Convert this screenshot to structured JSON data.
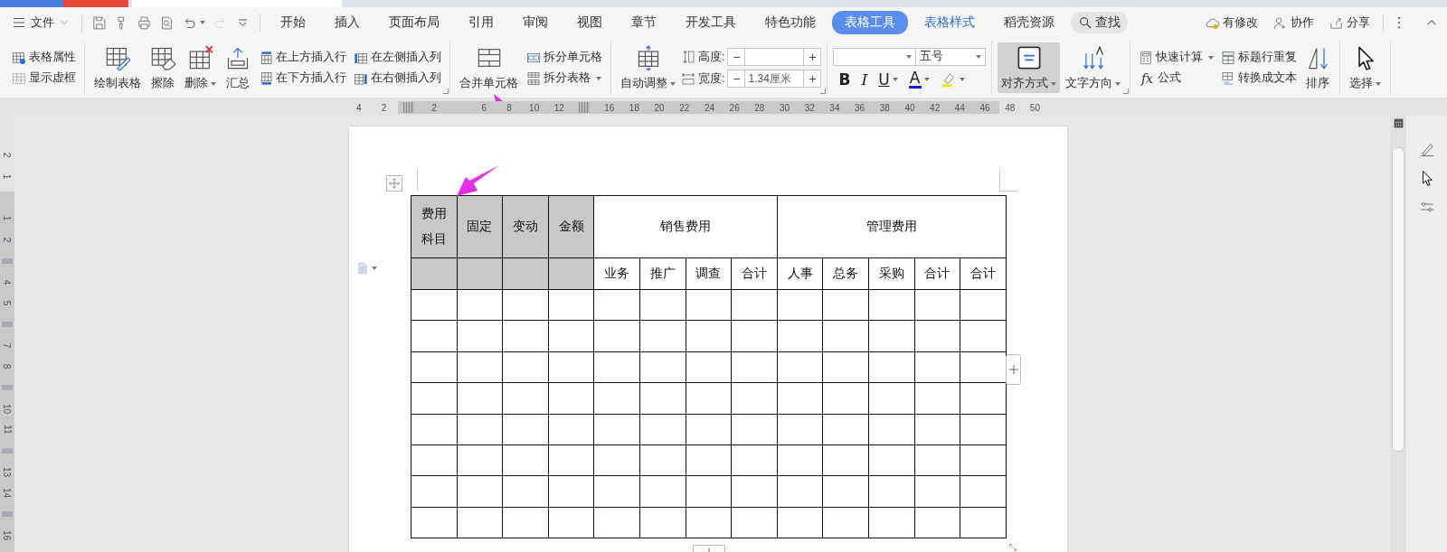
{
  "menu_bar": {
    "file_menu": "文件",
    "quick_access": [
      {
        "kind": "save",
        "dropdown": false,
        "disabled": false
      },
      {
        "kind": "format-painter",
        "dropdown": false,
        "disabled": false
      },
      {
        "kind": "print",
        "dropdown": false,
        "disabled": false
      },
      {
        "kind": "preview",
        "dropdown": false,
        "disabled": false
      },
      {
        "kind": "undo",
        "dropdown": true,
        "disabled": false
      },
      {
        "kind": "redo",
        "dropdown": false,
        "disabled": true
      },
      {
        "kind": "customize",
        "dropdown": false,
        "disabled": false
      }
    ],
    "tabs": [
      {
        "label": "开始",
        "selected": false,
        "contextual": false
      },
      {
        "label": "插入",
        "selected": false,
        "contextual": false
      },
      {
        "label": "页面布局",
        "selected": false,
        "contextual": false
      },
      {
        "label": "引用",
        "selected": false,
        "contextual": false
      },
      {
        "label": "审阅",
        "selected": false,
        "contextual": false
      },
      {
        "label": "视图",
        "selected": false,
        "contextual": false
      },
      {
        "label": "章节",
        "selected": false,
        "contextual": false
      },
      {
        "label": "开发工具",
        "selected": false,
        "contextual": false
      },
      {
        "label": "特色功能",
        "selected": false,
        "contextual": false
      },
      {
        "label": "表格工具",
        "selected": true,
        "contextual": true
      },
      {
        "label": "表格样式",
        "selected": false,
        "contextual": true
      },
      {
        "label": "稻壳资源",
        "selected": false,
        "contextual": false
      }
    ],
    "search": "查找",
    "actions": [
      {
        "kind": "cloud",
        "label": "有修改"
      },
      {
        "kind": "person-plus",
        "label": "协作"
      },
      {
        "kind": "share",
        "label": "分享"
      }
    ]
  },
  "ribbon": {
    "groups": [
      {
        "launcher": false,
        "items": [
          {
            "kind": "stack",
            "buttons": [
              {
                "label": "表格属性",
                "dropdown": false
              },
              {
                "label": "显示虚框",
                "dropdown": false
              }
            ]
          }
        ]
      },
      {
        "launcher": true,
        "items": [
          {
            "kind": "large",
            "label": "绘制表格",
            "dropdown": false,
            "selected": false
          },
          {
            "kind": "large",
            "label": "擦除",
            "dropdown": false,
            "selected": false
          },
          {
            "kind": "large",
            "label": "删除",
            "dropdown": true,
            "selected": false
          },
          {
            "kind": "large",
            "label": "汇总",
            "dropdown": false,
            "selected": false
          },
          {
            "kind": "stack",
            "buttons": [
              {
                "label": "在上方插入行",
                "dropdown": false
              },
              {
                "label": "在下方插入行",
                "dropdown": false
              }
            ]
          },
          {
            "kind": "stack",
            "buttons": [
              {
                "label": "在左侧插入列",
                "dropdown": false
              },
              {
                "label": "在右侧插入列",
                "dropdown": false
              }
            ]
          }
        ]
      },
      {
        "launcher": false,
        "items": [
          {
            "kind": "large",
            "label": "合并单元格",
            "dropdown": false,
            "selected": false
          },
          {
            "kind": "stack",
            "buttons": [
              {
                "label": "拆分单元格",
                "dropdown": false
              },
              {
                "label": "拆分表格",
                "dropdown": true
              }
            ]
          }
        ]
      },
      {
        "launcher": true,
        "items": [
          {
            "kind": "large",
            "label": "自动调整",
            "dropdown": true,
            "selected": false
          },
          {
            "kind": "spin",
            "rows": [
              {
                "label": "高度:",
                "decrement": "−",
                "increment": "+"
              },
              {
                "label": "宽度:",
                "value": "1.34厘米",
                "decrement": "−",
                "increment": "+"
              }
            ]
          }
        ]
      },
      {
        "launcher": false,
        "items": [
          {
            "kind": "font",
            "size": "五号",
            "formats": [
              {
                "kind": "bold",
                "text": "B",
                "dropdown": false
              },
              {
                "kind": "italic",
                "text": "I",
                "dropdown": false
              },
              {
                "kind": "underline",
                "text": "U",
                "dropdown": true
              },
              {
                "kind": "color",
                "text": "A",
                "dropdown": true,
                "color": "#1a1ad0"
              },
              {
                "kind": "highlight",
                "dropdown": true,
                "color": "#f2e600"
              }
            ]
          }
        ]
      },
      {
        "launcher": true,
        "items": [
          {
            "kind": "large",
            "label": "对齐方式",
            "dropdown": true,
            "selected": true
          },
          {
            "kind": "large",
            "label": "文字方向",
            "dropdown": true,
            "selected": false
          }
        ]
      },
      {
        "launcher": false,
        "items": [
          {
            "kind": "stack",
            "buttons": [
              {
                "label": "快速计算",
                "dropdown": true
              },
              {
                "label": "公式",
                "icon_text": "fx",
                "dropdown": false
              }
            ]
          },
          {
            "kind": "stack",
            "buttons": [
              {
                "label": "标题行重复",
                "dropdown": false
              },
              {
                "label": "转换成文本",
                "dropdown": false
              }
            ]
          },
          {
            "kind": "large",
            "label": "排序",
            "dropdown": false,
            "selected": false
          }
        ]
      },
      {
        "launcher": false,
        "items": [
          {
            "kind": "large",
            "label": "选择",
            "dropdown": true,
            "selected": false
          }
        ]
      }
    ]
  },
  "horizontal_ruler": [
    {
      "kind": "number",
      "text": "4"
    },
    {
      "kind": "number",
      "text": "2"
    },
    {
      "kind": "marker"
    },
    {
      "kind": "number",
      "text": "2"
    },
    {
      "kind": "blank"
    },
    {
      "kind": "number",
      "text": "6"
    },
    {
      "kind": "number",
      "text": "8"
    },
    {
      "kind": "number",
      "text": "10"
    },
    {
      "kind": "number",
      "text": "12"
    },
    {
      "kind": "marker"
    },
    {
      "kind": "number",
      "text": "16"
    },
    {
      "kind": "number",
      "text": "18"
    },
    {
      "kind": "number",
      "text": "20"
    },
    {
      "kind": "number",
      "text": "22"
    },
    {
      "kind": "number",
      "text": "24"
    },
    {
      "kind": "number",
      "text": "26"
    },
    {
      "kind": "number",
      "text": "28"
    },
    {
      "kind": "number",
      "text": "30"
    },
    {
      "kind": "number",
      "text": "32"
    },
    {
      "kind": "number",
      "text": "34"
    },
    {
      "kind": "number",
      "text": "36"
    },
    {
      "kind": "number",
      "text": "38"
    },
    {
      "kind": "number",
      "text": "40"
    },
    {
      "kind": "number",
      "text": "42"
    },
    {
      "kind": "number",
      "text": "44"
    },
    {
      "kind": "number",
      "text": "46"
    },
    {
      "kind": "number",
      "text": "48"
    },
    {
      "kind": "number",
      "text": "50"
    }
  ],
  "vertical_ruler": [
    {
      "kind": "number",
      "text": "2"
    },
    {
      "kind": "number",
      "text": "1"
    },
    {
      "kind": "blank"
    },
    {
      "kind": "number",
      "text": "1"
    },
    {
      "kind": "number",
      "text": "2"
    },
    {
      "kind": "marker"
    },
    {
      "kind": "number",
      "text": "4"
    },
    {
      "kind": "number",
      "text": "5"
    },
    {
      "kind": "marker"
    },
    {
      "kind": "number",
      "text": "7"
    },
    {
      "kind": "number",
      "text": "8"
    },
    {
      "kind": "marker"
    },
    {
      "kind": "number",
      "text": "10"
    },
    {
      "kind": "number",
      "text": "11"
    },
    {
      "kind": "marker"
    },
    {
      "kind": "number",
      "text": "13"
    },
    {
      "kind": "number",
      "text": "14"
    },
    {
      "kind": "marker"
    },
    {
      "kind": "number",
      "text": "16"
    }
  ],
  "table": {
    "fixed_columns": [
      {
        "lines": [
          "费用",
          "科目"
        ],
        "shaded": true
      },
      {
        "lines": [
          "固定"
        ],
        "shaded": true
      },
      {
        "lines": [
          "变动"
        ],
        "shaded": true
      },
      {
        "lines": [
          "金额"
        ],
        "shaded": true
      }
    ],
    "groups": [
      {
        "title": "销售费用",
        "columns": [
          "业务",
          "推广",
          "调查",
          "合计"
        ]
      },
      {
        "title": "管理费用",
        "columns": [
          "人事",
          "总务",
          "采购",
          "合计",
          "合计"
        ]
      }
    ],
    "body_rows": [
      {
        "kind": "blank"
      },
      {
        "kind": "blank"
      },
      {
        "kind": "blank"
      },
      {
        "kind": "blank"
      },
      {
        "kind": "blank"
      },
      {
        "kind": "blank"
      },
      {
        "kind": "blank"
      },
      {
        "kind": "blank"
      }
    ]
  }
}
